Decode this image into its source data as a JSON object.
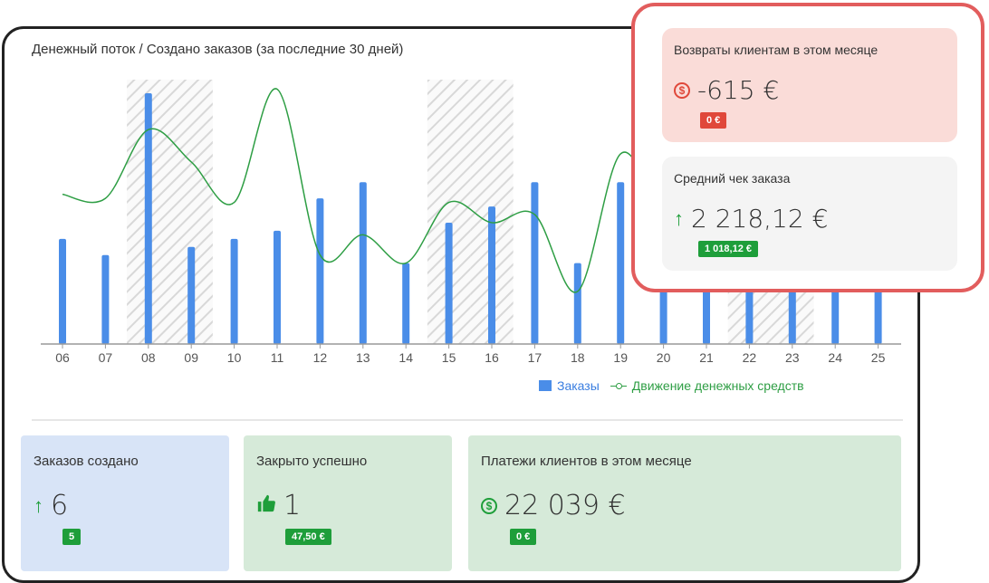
{
  "chart": {
    "title": "Денежный поток / Создано заказов (за последние 30 дней)",
    "legend_orders": "Заказы",
    "legend_cash": "Движение денежных средств"
  },
  "chart_data": {
    "type": "bar",
    "title": "Денежный поток / Создано заказов (за последние 30 дней)",
    "categories": [
      "06",
      "07",
      "08",
      "09",
      "10",
      "11",
      "12",
      "13",
      "14",
      "15",
      "16",
      "17",
      "18",
      "19",
      "20",
      "21",
      "22",
      "23",
      "24",
      "25"
    ],
    "series": [
      {
        "name": "Заказы",
        "type": "bar",
        "values": [
          13,
          11,
          31,
          12,
          13,
          14,
          18,
          20,
          10,
          15,
          17,
          20,
          10,
          20,
          14,
          14,
          13,
          15,
          16,
          18
        ]
      },
      {
        "name": "Движение денежных средств",
        "type": "line",
        "values": [
          18.5,
          18,
          26.5,
          22.5,
          17.5,
          31.5,
          11,
          13.5,
          10,
          17.5,
          15,
          16,
          6.5,
          23.5,
          16,
          15,
          14,
          15,
          16,
          17
        ]
      }
    ],
    "hatched_categories": [
      "08",
      "09",
      "15",
      "16",
      "22",
      "23"
    ],
    "colors": {
      "bars": "#4a8de8",
      "line": "#2e9e44"
    },
    "ylim": [
      0,
      32
    ],
    "legend": "bottom-right"
  },
  "cards": {
    "orders_created": {
      "title": "Заказов создано",
      "value": "6",
      "badge": "5",
      "icon": "arrow-up-icon"
    },
    "closed_success": {
      "title": "Закрыто успешно",
      "value": "1",
      "badge": "47,50 €",
      "icon": "thumbs-up-icon"
    },
    "payments": {
      "title": "Платежи клиентов в этом месяце",
      "value": "22 039 €",
      "badge": "0 €",
      "icon": "dollar-circle-icon"
    }
  },
  "overlay": {
    "returns": {
      "title": "Возвраты клиентам в этом месяце",
      "value": "-615 €",
      "badge": "0 €",
      "icon": "dollar-circle-icon"
    },
    "avg_check": {
      "title": "Средний чек заказа",
      "value": "2 218,12 €",
      "badge": "1 018,12 €",
      "icon": "arrow-up-icon"
    }
  },
  "colors": {
    "green": "#1e9e3a",
    "red": "#e0483a",
    "blue_card": "#d8e4f7",
    "green_card": "#d6ead9",
    "red_card": "#fadcd8"
  }
}
